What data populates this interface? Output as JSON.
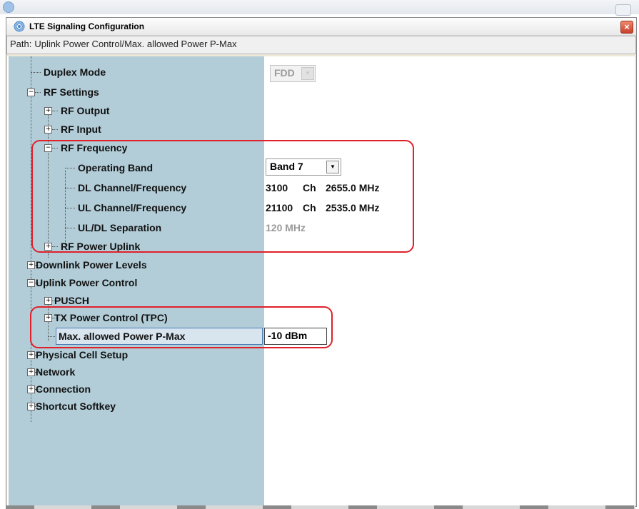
{
  "window": {
    "title": "LTE Signaling Configuration",
    "close_glyph": "×",
    "path_label": "Path:",
    "path_value": "Uplink Power Control/Max. allowed Power P-Max"
  },
  "tree": {
    "duplex_mode": {
      "label": "Duplex Mode",
      "value": "FDD"
    },
    "rf_settings": {
      "label": "RF Settings"
    },
    "rf_output": {
      "label": "RF Output"
    },
    "rf_input": {
      "label": "RF Input"
    },
    "rf_frequency": {
      "label": "RF Frequency"
    },
    "operating_band": {
      "label": "Operating Band",
      "value": "Band 7"
    },
    "dl_channel": {
      "label": "DL Channel/Frequency",
      "channel": "3100",
      "unit_ch": "Ch",
      "frequency": "2655.0 MHz"
    },
    "ul_channel": {
      "label": "UL Channel/Frequency",
      "channel": "21100",
      "unit_ch": "Ch",
      "frequency": "2535.0 MHz"
    },
    "ul_dl_separation": {
      "label": "UL/DL Separation",
      "value": "120 MHz"
    },
    "rf_power_uplink": {
      "label": "RF Power Uplink"
    },
    "downlink_power_levels": {
      "label": "Downlink Power Levels"
    },
    "uplink_power_control": {
      "label": "Uplink Power Control"
    },
    "pusch": {
      "label": "PUSCH"
    },
    "tx_power_control": {
      "label": "TX Power Control (TPC)"
    },
    "max_power": {
      "label": "Max. allowed Power P-Max",
      "value": "-10 dBm"
    },
    "physical_cell_setup": {
      "label": "Physical Cell Setup"
    },
    "network": {
      "label": "Network"
    },
    "connection": {
      "label": "Connection"
    },
    "shortcut_softkey": {
      "label": "Shortcut Softkey"
    }
  },
  "icons": {
    "expand": "+",
    "collapse": "−",
    "dropdown": "▼"
  },
  "colors": {
    "tree_background": "#b2cdd8",
    "highlight": "#e0202a",
    "disabled_text": "#9a9a9a"
  }
}
